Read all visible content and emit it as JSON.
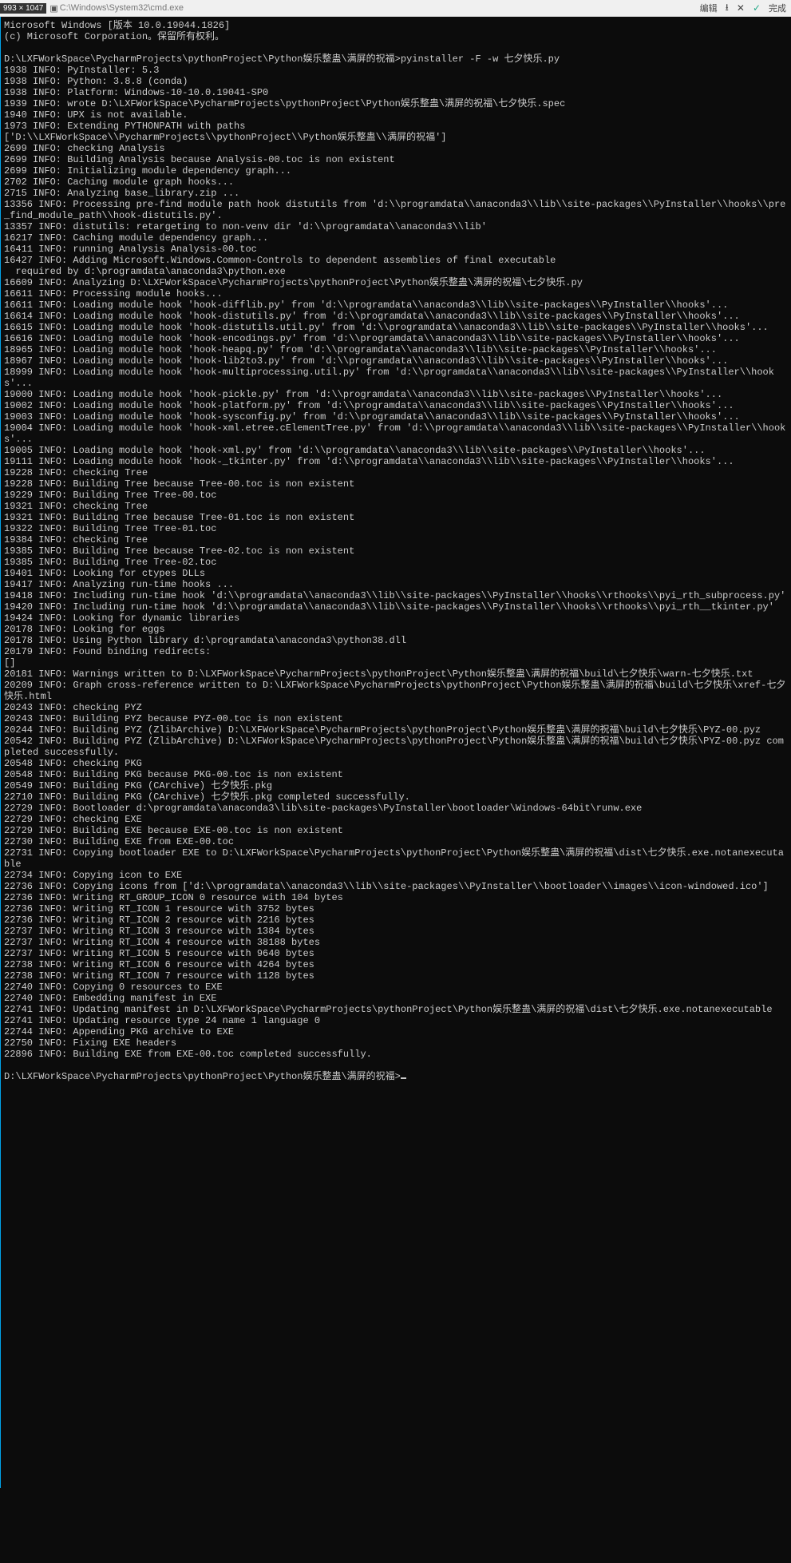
{
  "top": {
    "dim": "993 × 1047",
    "title": "C:\\Windows\\System32\\cmd.exe",
    "actions": {
      "edit": "编辑",
      "done": "完成"
    }
  },
  "header": {
    "l1": "Microsoft Windows [版本 10.0.19044.1826]",
    "l2": "(c) Microsoft Corporation。保留所有权利。"
  },
  "cmd": {
    "prompt1": "D:\\LXFWorkSpace\\PycharmProjects\\pythonProject\\Python娱乐整蛊\\满屏的祝福>",
    "input": "pyinstaller -F -w 七夕快乐.py",
    "prompt2": "D:\\LXFWorkSpace\\PycharmProjects\\pythonProject\\Python娱乐整蛊\\满屏的祝福>"
  },
  "log": [
    "1938 INFO: PyInstaller: 5.3",
    "1938 INFO: Python: 3.8.8 (conda)",
    "1938 INFO: Platform: Windows-10-10.0.19041-SP0",
    "1939 INFO: wrote D:\\LXFWorkSpace\\PycharmProjects\\pythonProject\\Python娱乐整蛊\\满屏的祝福\\七夕快乐.spec",
    "1940 INFO: UPX is not available.",
    "1973 INFO: Extending PYTHONPATH with paths",
    "['D:\\\\LXFWorkSpace\\\\PycharmProjects\\\\pythonProject\\\\Python娱乐整蛊\\\\满屏的祝福']",
    "2699 INFO: checking Analysis",
    "2699 INFO: Building Analysis because Analysis-00.toc is non existent",
    "2699 INFO: Initializing module dependency graph...",
    "2702 INFO: Caching module graph hooks...",
    "2715 INFO: Analyzing base_library.zip ...",
    "13356 INFO: Processing pre-find module path hook distutils from 'd:\\\\programdata\\\\anaconda3\\\\lib\\\\site-packages\\\\PyInstaller\\\\hooks\\\\pre_find_module_path\\\\hook-distutils.py'.",
    "13357 INFO: distutils: retargeting to non-venv dir 'd:\\\\programdata\\\\anaconda3\\\\lib'",
    "16217 INFO: Caching module dependency graph...",
    "16411 INFO: running Analysis Analysis-00.toc",
    "16427 INFO: Adding Microsoft.Windows.Common-Controls to dependent assemblies of final executable",
    "  required by d:\\programdata\\anaconda3\\python.exe",
    "16609 INFO: Analyzing D:\\LXFWorkSpace\\PycharmProjects\\pythonProject\\Python娱乐整蛊\\满屏的祝福\\七夕快乐.py",
    "16611 INFO: Processing module hooks...",
    "16611 INFO: Loading module hook 'hook-difflib.py' from 'd:\\\\programdata\\\\anaconda3\\\\lib\\\\site-packages\\\\PyInstaller\\\\hooks'...",
    "16614 INFO: Loading module hook 'hook-distutils.py' from 'd:\\\\programdata\\\\anaconda3\\\\lib\\\\site-packages\\\\PyInstaller\\\\hooks'...",
    "16615 INFO: Loading module hook 'hook-distutils.util.py' from 'd:\\\\programdata\\\\anaconda3\\\\lib\\\\site-packages\\\\PyInstaller\\\\hooks'...",
    "16616 INFO: Loading module hook 'hook-encodings.py' from 'd:\\\\programdata\\\\anaconda3\\\\lib\\\\site-packages\\\\PyInstaller\\\\hooks'...",
    "18965 INFO: Loading module hook 'hook-heapq.py' from 'd:\\\\programdata\\\\anaconda3\\\\lib\\\\site-packages\\\\PyInstaller\\\\hooks'...",
    "18967 INFO: Loading module hook 'hook-lib2to3.py' from 'd:\\\\programdata\\\\anaconda3\\\\lib\\\\site-packages\\\\PyInstaller\\\\hooks'...",
    "18999 INFO: Loading module hook 'hook-multiprocessing.util.py' from 'd:\\\\programdata\\\\anaconda3\\\\lib\\\\site-packages\\\\PyInstaller\\\\hooks'...",
    "19000 INFO: Loading module hook 'hook-pickle.py' from 'd:\\\\programdata\\\\anaconda3\\\\lib\\\\site-packages\\\\PyInstaller\\\\hooks'...",
    "19002 INFO: Loading module hook 'hook-platform.py' from 'd:\\\\programdata\\\\anaconda3\\\\lib\\\\site-packages\\\\PyInstaller\\\\hooks'...",
    "19003 INFO: Loading module hook 'hook-sysconfig.py' from 'd:\\\\programdata\\\\anaconda3\\\\lib\\\\site-packages\\\\PyInstaller\\\\hooks'...",
    "19004 INFO: Loading module hook 'hook-xml.etree.cElementTree.py' from 'd:\\\\programdata\\\\anaconda3\\\\lib\\\\site-packages\\\\PyInstaller\\\\hooks'...",
    "19005 INFO: Loading module hook 'hook-xml.py' from 'd:\\\\programdata\\\\anaconda3\\\\lib\\\\site-packages\\\\PyInstaller\\\\hooks'...",
    "19111 INFO: Loading module hook 'hook-_tkinter.py' from 'd:\\\\programdata\\\\anaconda3\\\\lib\\\\site-packages\\\\PyInstaller\\\\hooks'...",
    "19228 INFO: checking Tree",
    "19228 INFO: Building Tree because Tree-00.toc is non existent",
    "19229 INFO: Building Tree Tree-00.toc",
    "19321 INFO: checking Tree",
    "19321 INFO: Building Tree because Tree-01.toc is non existent",
    "19322 INFO: Building Tree Tree-01.toc",
    "19384 INFO: checking Tree",
    "19385 INFO: Building Tree because Tree-02.toc is non existent",
    "19385 INFO: Building Tree Tree-02.toc",
    "19401 INFO: Looking for ctypes DLLs",
    "19417 INFO: Analyzing run-time hooks ...",
    "19418 INFO: Including run-time hook 'd:\\\\programdata\\\\anaconda3\\\\lib\\\\site-packages\\\\PyInstaller\\\\hooks\\\\rthooks\\\\pyi_rth_subprocess.py'",
    "19420 INFO: Including run-time hook 'd:\\\\programdata\\\\anaconda3\\\\lib\\\\site-packages\\\\PyInstaller\\\\hooks\\\\rthooks\\\\pyi_rth__tkinter.py'",
    "19424 INFO: Looking for dynamic libraries",
    "20178 INFO: Looking for eggs",
    "20178 INFO: Using Python library d:\\programdata\\anaconda3\\python38.dll",
    "20179 INFO: Found binding redirects:",
    "[]",
    "20181 INFO: Warnings written to D:\\LXFWorkSpace\\PycharmProjects\\pythonProject\\Python娱乐整蛊\\满屏的祝福\\build\\七夕快乐\\warn-七夕快乐.txt",
    "20209 INFO: Graph cross-reference written to D:\\LXFWorkSpace\\PycharmProjects\\pythonProject\\Python娱乐整蛊\\满屏的祝福\\build\\七夕快乐\\xref-七夕快乐.html",
    "20243 INFO: checking PYZ",
    "20243 INFO: Building PYZ because PYZ-00.toc is non existent",
    "20244 INFO: Building PYZ (ZlibArchive) D:\\LXFWorkSpace\\PycharmProjects\\pythonProject\\Python娱乐整蛊\\满屏的祝福\\build\\七夕快乐\\PYZ-00.pyz",
    "20542 INFO: Building PYZ (ZlibArchive) D:\\LXFWorkSpace\\PycharmProjects\\pythonProject\\Python娱乐整蛊\\满屏的祝福\\build\\七夕快乐\\PYZ-00.pyz completed successfully.",
    "20548 INFO: checking PKG",
    "20548 INFO: Building PKG because PKG-00.toc is non existent",
    "20549 INFO: Building PKG (CArchive) 七夕快乐.pkg",
    "22710 INFO: Building PKG (CArchive) 七夕快乐.pkg completed successfully.",
    "22729 INFO: Bootloader d:\\programdata\\anaconda3\\lib\\site-packages\\PyInstaller\\bootloader\\Windows-64bit\\runw.exe",
    "22729 INFO: checking EXE",
    "22729 INFO: Building EXE because EXE-00.toc is non existent",
    "22730 INFO: Building EXE from EXE-00.toc",
    "22731 INFO: Copying bootloader EXE to D:\\LXFWorkSpace\\PycharmProjects\\pythonProject\\Python娱乐整蛊\\满屏的祝福\\dist\\七夕快乐.exe.notanexecutable",
    "22734 INFO: Copying icon to EXE",
    "22736 INFO: Copying icons from ['d:\\\\programdata\\\\anaconda3\\\\lib\\\\site-packages\\\\PyInstaller\\\\bootloader\\\\images\\\\icon-windowed.ico']",
    "22736 INFO: Writing RT_GROUP_ICON 0 resource with 104 bytes",
    "22736 INFO: Writing RT_ICON 1 resource with 3752 bytes",
    "22736 INFO: Writing RT_ICON 2 resource with 2216 bytes",
    "22737 INFO: Writing RT_ICON 3 resource with 1384 bytes",
    "22737 INFO: Writing RT_ICON 4 resource with 38188 bytes",
    "22737 INFO: Writing RT_ICON 5 resource with 9640 bytes",
    "22738 INFO: Writing RT_ICON 6 resource with 4264 bytes",
    "22738 INFO: Writing RT_ICON 7 resource with 1128 bytes",
    "22740 INFO: Copying 0 resources to EXE",
    "22740 INFO: Embedding manifest in EXE",
    "22741 INFO: Updating manifest in D:\\LXFWorkSpace\\PycharmProjects\\pythonProject\\Python娱乐整蛊\\满屏的祝福\\dist\\七夕快乐.exe.notanexecutable",
    "22741 INFO: Updating resource type 24 name 1 language 0",
    "22744 INFO: Appending PKG archive to EXE",
    "22750 INFO: Fixing EXE headers",
    "22896 INFO: Building EXE from EXE-00.toc completed successfully."
  ]
}
